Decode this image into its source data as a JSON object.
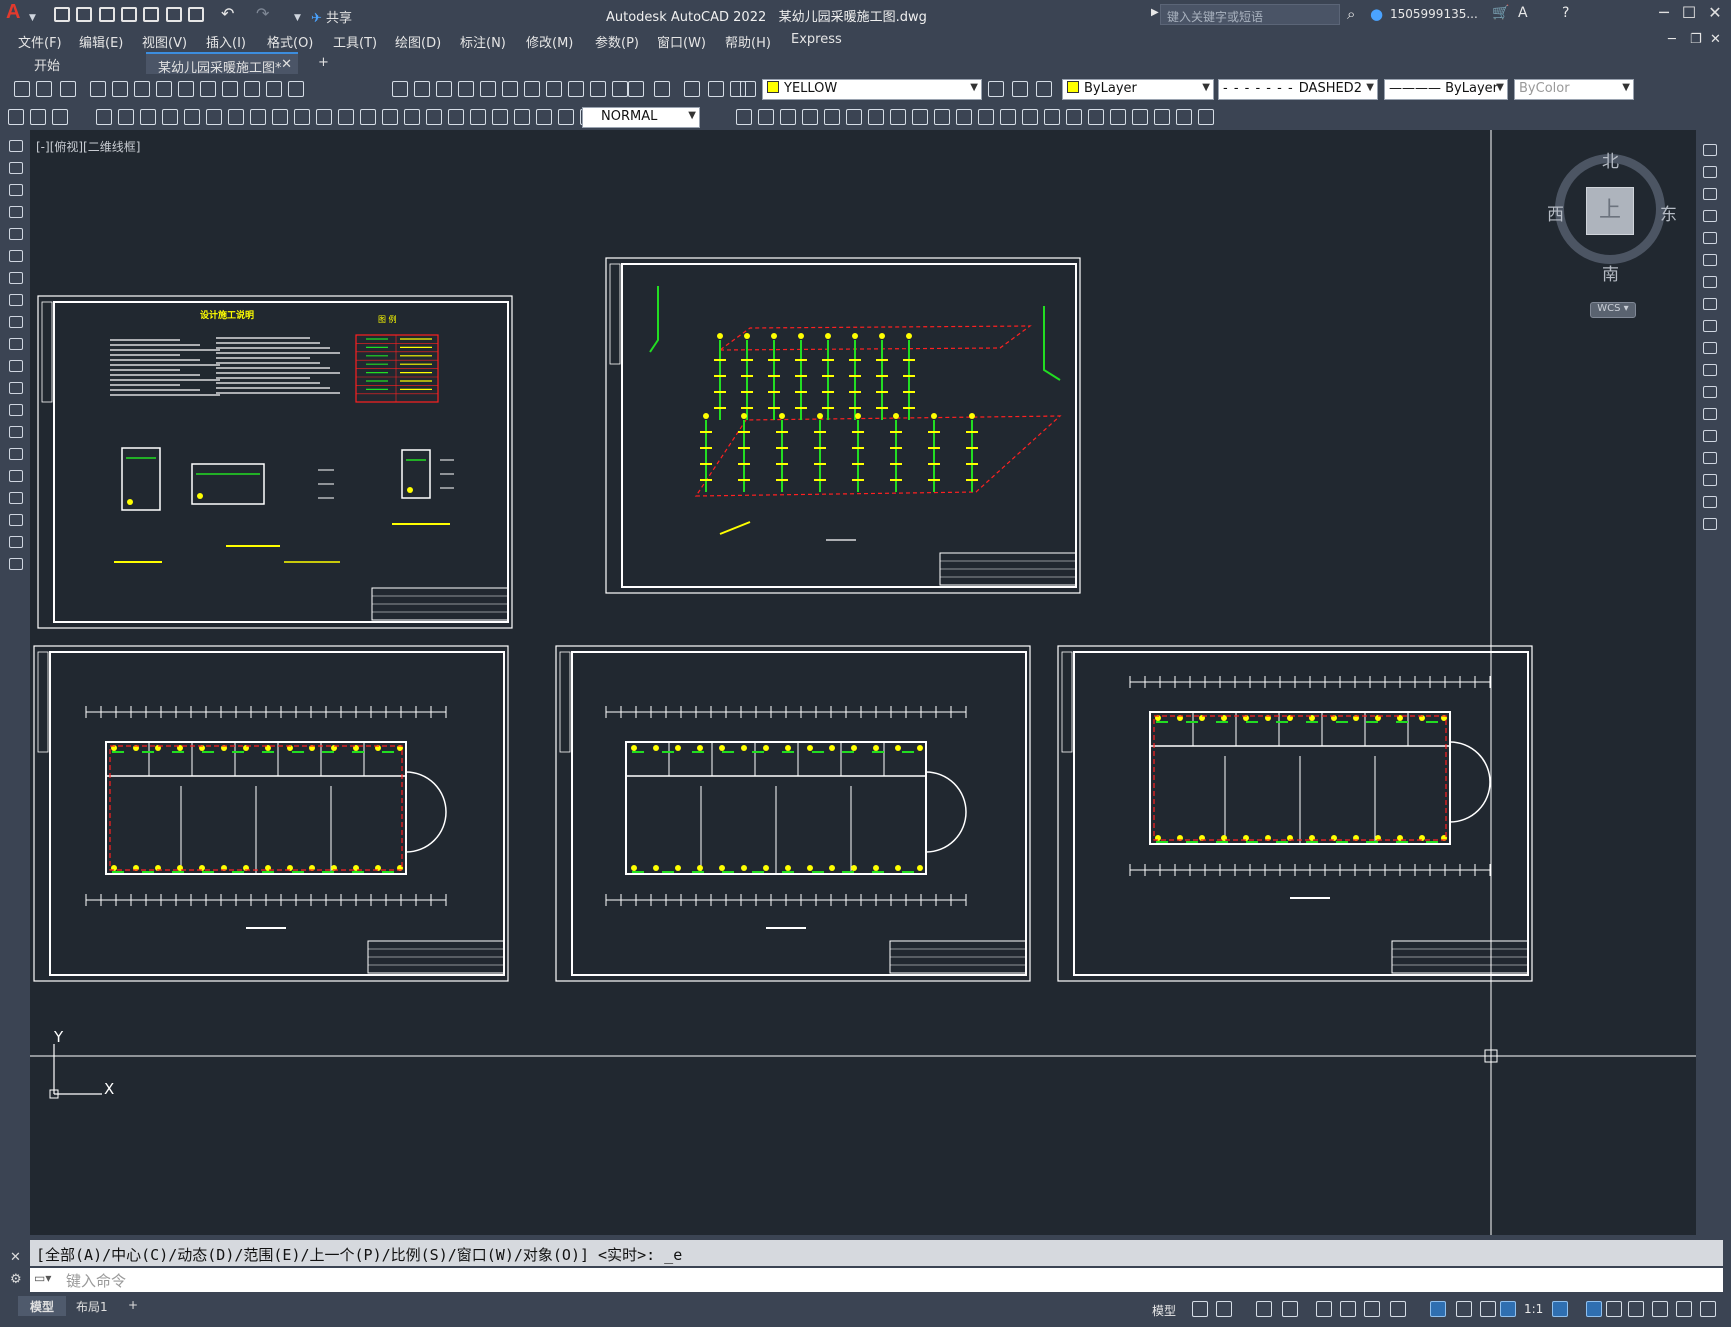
{
  "app": {
    "name": "Autodesk AutoCAD 2022",
    "file": "某幼儿园采暖施工图.dwg",
    "share_label": "共享",
    "search_placeholder": "键入关键字或短语",
    "user": "1505999135..."
  },
  "menu": [
    "文件(F)",
    "编辑(E)",
    "视图(V)",
    "插入(I)",
    "格式(O)",
    "工具(T)",
    "绘图(D)",
    "标注(N)",
    "修改(M)",
    "参数(P)",
    "窗口(W)",
    "帮助(H)",
    "Express"
  ],
  "tabs": {
    "start": "开始",
    "active": "某幼儿园采暖施工图*"
  },
  "properties": {
    "layer": "YELLOW",
    "color": "ByLayer",
    "linetype": "DASHED2",
    "lineweight": "ByLayer",
    "plotstyle": "ByColor",
    "dimstyle": "NORMAL"
  },
  "viewport": {
    "label": "[-][俯视][二维线框]"
  },
  "viewcube": {
    "north": "北",
    "south": "南",
    "east": "东",
    "west": "西",
    "face": "上",
    "wcs": "WCS"
  },
  "ucs": {
    "x": "X",
    "y": "Y"
  },
  "drawing_sheets": {
    "design_notes_title": "设计施工说明",
    "legend_title": "图 例"
  },
  "command": {
    "history": "[全部(A)/中心(C)/动态(D)/范围(E)/上一个(P)/比例(S)/窗口(W)/对象(O)] <实时>: _e",
    "placeholder": "键入命令"
  },
  "layout_tabs": [
    "模型",
    "布局1"
  ],
  "status": {
    "model": "模型",
    "scale": "1:1"
  },
  "colors": {
    "background": "#212830",
    "chrome": "#3b4453",
    "green": "#22dd22",
    "yellow": "#ffff00",
    "red": "#ff2020",
    "white": "#ffffff"
  }
}
